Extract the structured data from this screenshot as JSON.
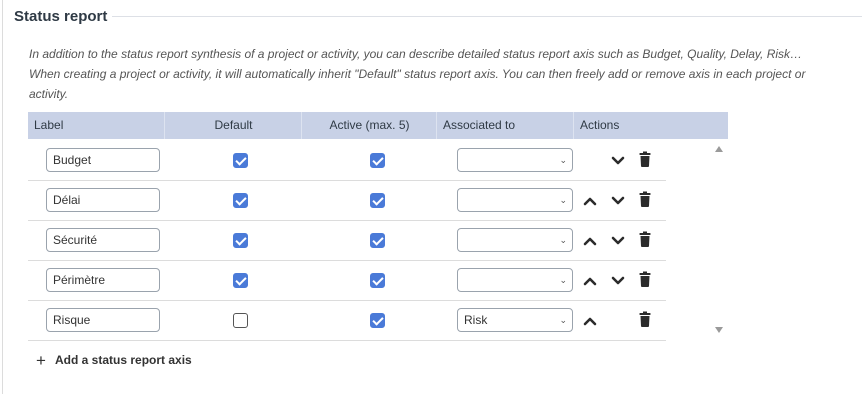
{
  "section": {
    "title": "Status report",
    "description": "In addition to the status report synthesis of a project or activity, you can describe detailed status report axis such as Budget, Quality, Delay, Risk… When creating a project or activity, it will automatically inherit \"Default\" status report axis. You can then freely add or remove axis in each project or activity."
  },
  "table": {
    "columns": [
      "Label",
      "Default",
      "Active (max. 5)",
      "Associated to",
      "Actions"
    ],
    "rows": [
      {
        "label": "Budget",
        "default": true,
        "active": true,
        "associated": "",
        "can_move_up": false,
        "can_move_down": true
      },
      {
        "label": "Délai",
        "default": true,
        "active": true,
        "associated": "",
        "can_move_up": true,
        "can_move_down": true
      },
      {
        "label": "Sécurité",
        "default": true,
        "active": true,
        "associated": "",
        "can_move_up": true,
        "can_move_down": true
      },
      {
        "label": "Périmètre",
        "default": true,
        "active": true,
        "associated": "",
        "can_move_up": true,
        "can_move_down": true
      },
      {
        "label": "Risque",
        "default": false,
        "active": true,
        "associated": "Risk",
        "can_move_up": true,
        "can_move_down": false
      }
    ]
  },
  "add_button": {
    "label": "Add a status report axis",
    "icon": "plus-icon"
  },
  "icons": {
    "move_up": "chevron-up-icon",
    "move_down": "chevron-down-icon",
    "delete": "trash-icon",
    "select": "select-caret-icon"
  },
  "colors": {
    "header_bg": "#c8d1e6",
    "checkbox": "#4a7ad8",
    "text": "#2f3a45"
  }
}
